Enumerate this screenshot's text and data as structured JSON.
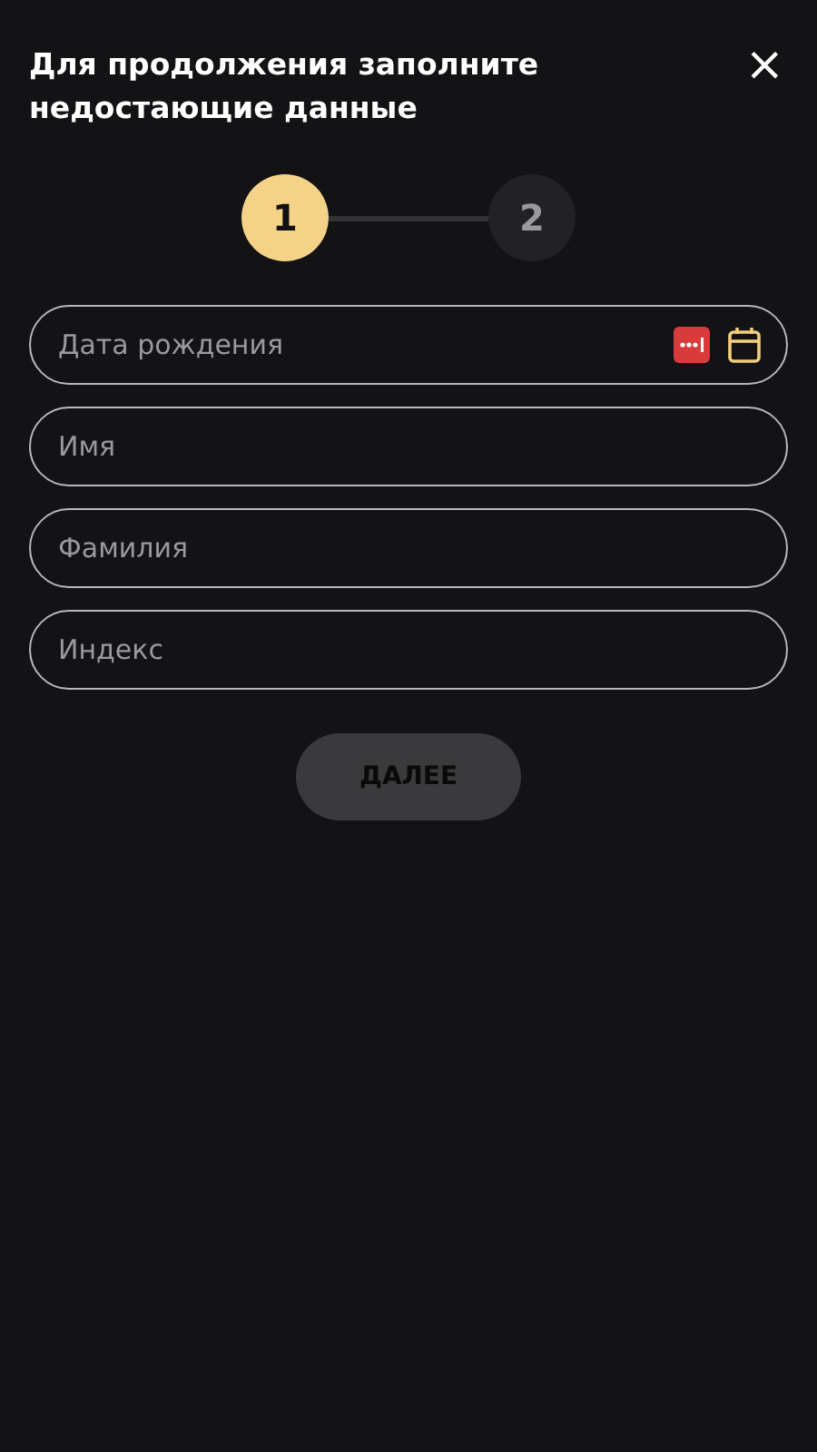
{
  "dialog": {
    "title": "Для продолжения заполните недостающие данные",
    "close": "×"
  },
  "steps": [
    {
      "label": "1",
      "selected": true
    },
    {
      "label": "2",
      "selected": false
    }
  ],
  "fields": [
    {
      "kind": "date",
      "placeholder": "Дата рождения"
    },
    {
      "kind": "text",
      "placeholder": "Имя"
    },
    {
      "kind": "text",
      "placeholder": "Фамилия"
    },
    {
      "kind": "text",
      "placeholder": "Индекс"
    }
  ],
  "next_button": {
    "label": "ДАЛЕЕ",
    "disabled": true
  }
}
